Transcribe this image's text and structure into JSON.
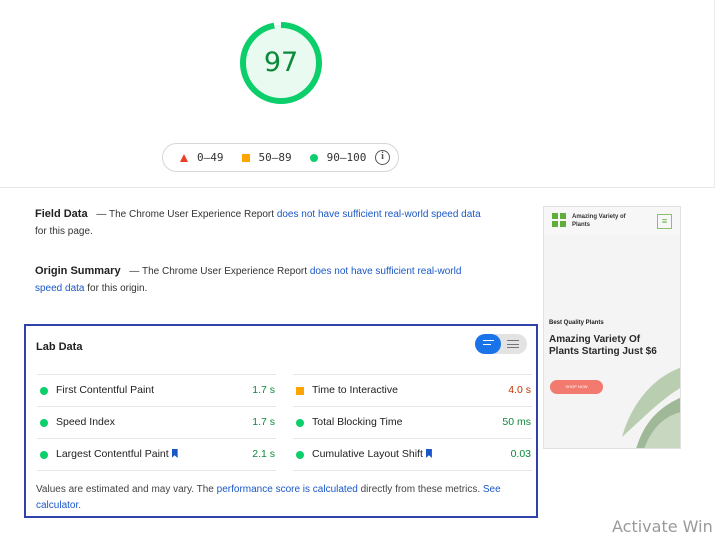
{
  "score": {
    "value": "97",
    "fraction": 0.97,
    "ring_color": "#0cce6b",
    "fill_color": "#e9faf0",
    "text_color": "#0c8a3a"
  },
  "legend": {
    "items": [
      {
        "icon": "triangle-icon",
        "label": "0–49",
        "color": "#eb3f27"
      },
      {
        "icon": "square-icon",
        "label": "50–89",
        "color": "#ffa400"
      },
      {
        "icon": "circle-icon",
        "label": "90–100",
        "color": "#0cce6b"
      }
    ],
    "info_icon": "info-icon"
  },
  "field_data": {
    "title": "Field Data",
    "prefix": "— The Chrome User Experience Report ",
    "link": "does not have sufficient real-world speed data",
    "suffix": " for this page."
  },
  "origin_summary": {
    "title": "Origin Summary",
    "prefix": "— The Chrome User Experience Report ",
    "link": "does not have sufficient real-world speed data",
    "suffix": " for this origin."
  },
  "screenshot": {
    "site_name": "Amazing Variety of Plants",
    "menu_icon": "hamburger-icon",
    "kicker": "Best Quality Plants",
    "heading": "Amazing Variety Of Plants Starting Just $6",
    "button": "SHOP NOW"
  },
  "lab_data": {
    "title": "Lab Data",
    "toggle_icons": [
      "summary-view-icon",
      "list-view-icon"
    ],
    "metrics": [
      {
        "label": "First Contentful Paint",
        "value": "1.7 s",
        "status": "pass",
        "bookmark": false
      },
      {
        "label": "Time to Interactive",
        "value": "4.0 s",
        "status": "average",
        "bookmark": false
      },
      {
        "label": "Speed Index",
        "value": "1.7 s",
        "status": "pass",
        "bookmark": false
      },
      {
        "label": "Total Blocking Time",
        "value": "50 ms",
        "status": "pass",
        "bookmark": false
      },
      {
        "label": "Largest Contentful Paint",
        "value": "2.1 s",
        "status": "pass",
        "bookmark": true
      },
      {
        "label": "Cumulative Layout Shift",
        "value": "0.03",
        "status": "pass",
        "bookmark": true
      }
    ],
    "disclaimer": {
      "text1": "Values are estimated and may vary. The ",
      "link1": "performance score is calculated",
      "text2": " directly from these metrics. ",
      "link2": "See calculator."
    }
  },
  "watermark": "Activate Win",
  "colors": {
    "pass": "#0cce6b",
    "average": "#ffa400",
    "fail": "#eb3f27",
    "link": "#1a57c8",
    "lab_border": "#3041a7",
    "toggle_active": "#1a73e8"
  }
}
